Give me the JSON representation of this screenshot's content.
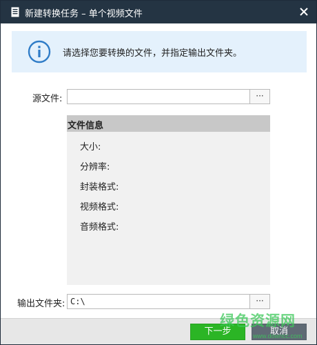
{
  "window": {
    "title": "新建转换任务 – 单个视频文件",
    "close_icon": "close-icon",
    "title_icon": "document-icon"
  },
  "banner": {
    "icon": "info-icon",
    "text": "请选择您要转换的文件，并指定输出文件夹。"
  },
  "source": {
    "label": "源文件:",
    "value": "",
    "browse_label": "···"
  },
  "file_info": {
    "header": "文件信息",
    "rows": [
      {
        "label": "大小:"
      },
      {
        "label": "分辨率:"
      },
      {
        "label": "封装格式:"
      },
      {
        "label": "视频格式:"
      },
      {
        "label": "音频格式:"
      }
    ]
  },
  "output": {
    "label": "输出文件夹:",
    "value": "C:\\",
    "browse_label": "···"
  },
  "footer": {
    "next_label": "下一步",
    "cancel_label": "取消"
  },
  "watermark": {
    "text": "绿色资源网",
    "url": "www.downcc.com"
  },
  "colors": {
    "titlebar": "#243443",
    "banner": "#e4f1fc",
    "next_button": "#2bb525",
    "cancel_button": "#5f6a74",
    "info_header": "#c8c8c8",
    "info_body": "#f1f1f1"
  }
}
